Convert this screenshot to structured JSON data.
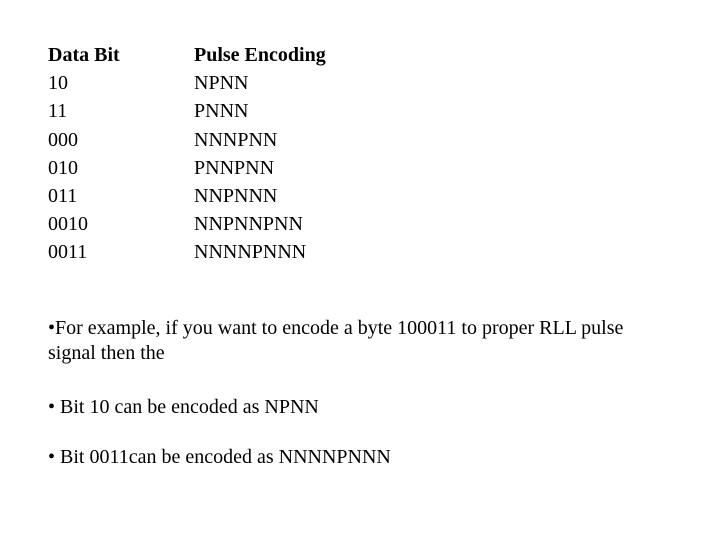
{
  "slide": {
    "background_color": "#ffffff",
    "text_color": "#000000"
  },
  "table": {
    "headers": {
      "data_bit": "Data Bit",
      "pulse_encoding": "Pulse Encoding"
    },
    "rows": [
      {
        "data_bit": "10",
        "pulse_encoding": "NPNN"
      },
      {
        "data_bit": "11",
        "pulse_encoding": "PNNN"
      },
      {
        "data_bit": "000",
        "pulse_encoding": "NNNPNN"
      },
      {
        "data_bit": "010",
        "pulse_encoding": "PNNPNN"
      },
      {
        "data_bit": "011",
        "pulse_encoding": "NNPNNN"
      },
      {
        "data_bit": "0010",
        "pulse_encoding": "NNPNNPNN"
      },
      {
        "data_bit": "0011",
        "pulse_encoding": "NNNNPNNN"
      }
    ]
  },
  "bullets": [
    {
      "marker": "•",
      "text": "For example, if you want to encode a byte 100011 to proper RLL pulse signal then the"
    },
    {
      "marker": "• ",
      "text": "Bit 10 can be encoded as NPNN"
    },
    {
      "marker": "• ",
      "text": "Bit 0011can be encoded as NNNNPNNN"
    }
  ]
}
